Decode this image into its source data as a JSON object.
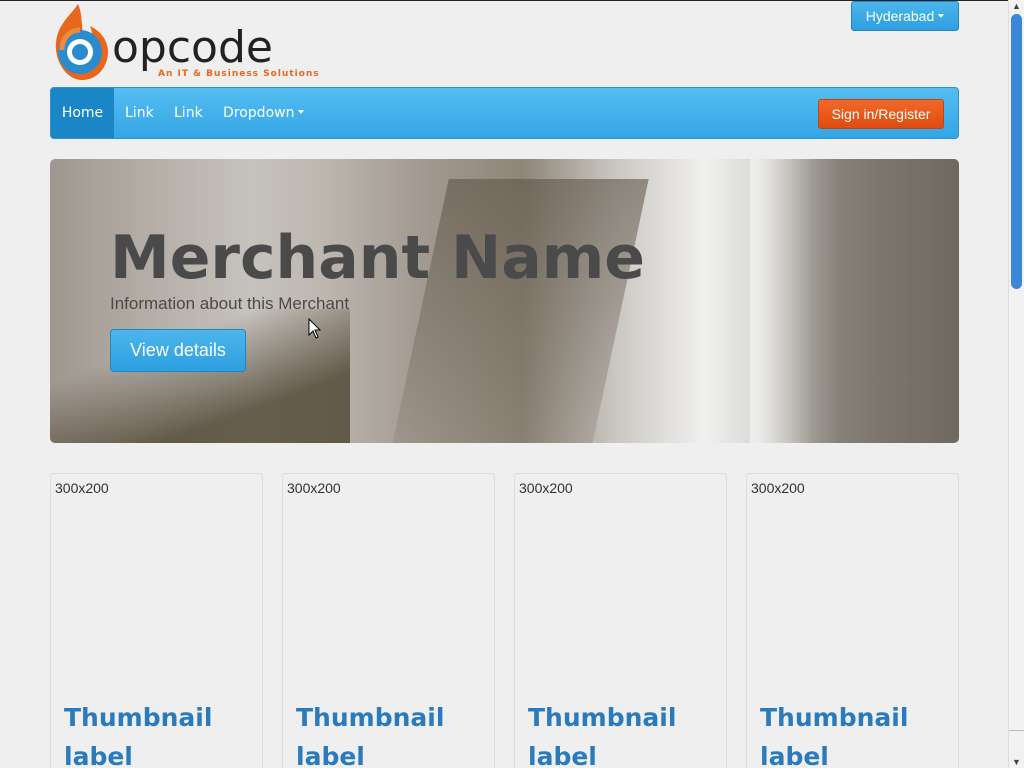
{
  "header": {
    "logo_text": "opcode",
    "logo_tagline": "An IT & Business Solutions",
    "city_button": "Hyderabad"
  },
  "navbar": {
    "items": [
      {
        "label": "Home",
        "active": true
      },
      {
        "label": "Link"
      },
      {
        "label": "Link"
      },
      {
        "label": "Dropdown"
      }
    ],
    "signin_label": "Sign in/Register"
  },
  "hero": {
    "title": "Merchant Name",
    "subtitle": "Information about this Merchant",
    "button_label": "View details"
  },
  "thumbnails": [
    {
      "image_label": "300x200",
      "title": "Thumbnail label"
    },
    {
      "image_label": "300x200",
      "title": "Thumbnail label"
    },
    {
      "image_label": "300x200",
      "title": "Thumbnail label"
    },
    {
      "image_label": "300x200",
      "title": "Thumbnail label"
    }
  ],
  "colors": {
    "navbar": "#34a6e6",
    "nav_active": "#1a86c6",
    "signin": "#e04b0f",
    "thumbnail_title": "#2a7bbd",
    "logo_accent": "#e8671c"
  },
  "icons": [
    "logo-flame-icon",
    "caret-down-icon",
    "mouse-cursor-icon",
    "scroll-up-arrow-icon",
    "scroll-down-arrow-icon"
  ]
}
